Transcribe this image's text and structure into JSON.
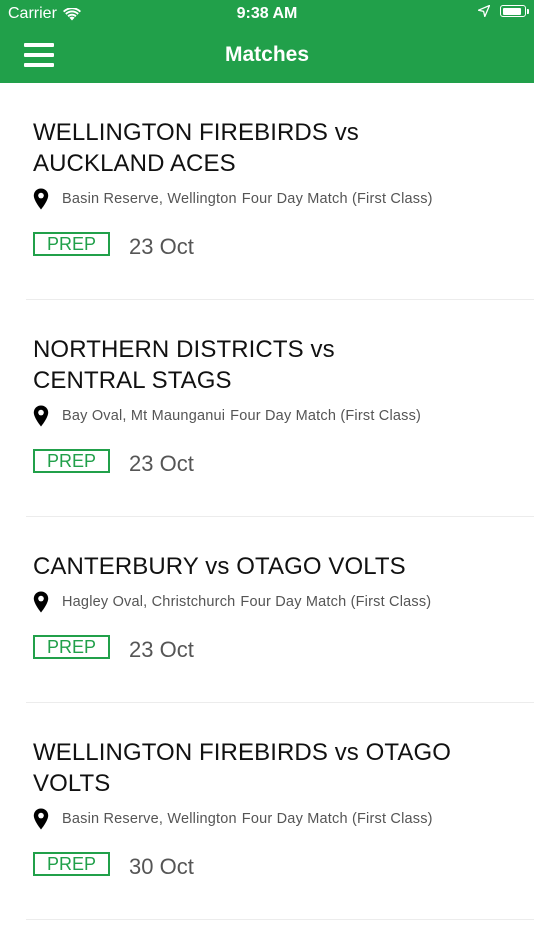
{
  "status_bar": {
    "carrier": "Carrier",
    "time": "9:38 AM",
    "battery_level": 0.9
  },
  "nav": {
    "title": "Matches"
  },
  "colors": {
    "brand_green": "#21a04a",
    "title_text": "#111111",
    "secondary_text": "#555555"
  },
  "matches": [
    {
      "title": "WELLINGTON FIREBIRDS vs AUCKLAND ACES",
      "venue": "Basin Reserve, Wellington",
      "format": "Four Day Match (First Class)",
      "status": "PREP",
      "date": "23 Oct"
    },
    {
      "title": "NORTHERN DISTRICTS vs CENTRAL STAGS",
      "venue": "Bay Oval, Mt Maunganui",
      "format": "Four Day Match (First Class)",
      "status": "PREP",
      "date": "23 Oct"
    },
    {
      "title": "CANTERBURY vs OTAGO VOLTS",
      "venue": "Hagley Oval, Christchurch",
      "format": "Four Day Match (First Class)",
      "status": "PREP",
      "date": "23 Oct"
    },
    {
      "title": "WELLINGTON FIREBIRDS vs OTAGO VOLTS",
      "venue": "Basin Reserve, Wellington",
      "format": "Four Day Match (First Class)",
      "status": "PREP",
      "date": "30 Oct"
    }
  ]
}
